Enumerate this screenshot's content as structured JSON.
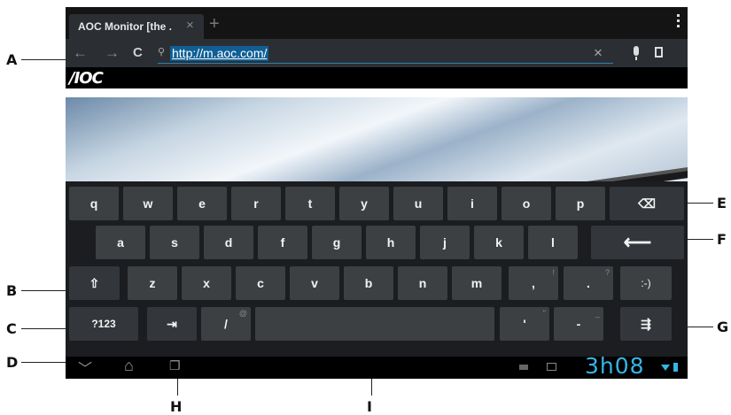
{
  "browser": {
    "tab_title": "AOC Monitor [the .",
    "tab_close": "×",
    "new_tab": "+",
    "url": "http://m.aoc.com/",
    "url_clear": "×",
    "back": "←",
    "forward": "→",
    "reload": "C",
    "search_glyph": "⚲"
  },
  "page": {
    "logo": "/IOC"
  },
  "keyboard": {
    "row1": [
      "q",
      "w",
      "e",
      "r",
      "t",
      "y",
      "u",
      "i",
      "o",
      "p"
    ],
    "row2": [
      "a",
      "s",
      "d",
      "f",
      "g",
      "h",
      "j",
      "k",
      "l"
    ],
    "row3": [
      "z",
      "x",
      "c",
      "v",
      "b",
      "n",
      "m"
    ],
    "comma": ",",
    "comma_hint": "!",
    "period": ".",
    "period_hint": "?",
    "smiley": ":-)",
    "symbols": "?123",
    "tab_glyph": "⇥",
    "slash": "/",
    "slash_hint": "@",
    "apostrophe": "'",
    "apostrophe_hint": "\"",
    "dash": "-",
    "dash_hint": "_",
    "backspace_glyph": "⌫",
    "enter_glyph": "⟵",
    "shift_glyph": "⇧",
    "settings_glyph": "⇶"
  },
  "system": {
    "time": "3h08",
    "back_glyph": "﹀",
    "home_glyph": "⌂",
    "recents_glyph": "❐"
  },
  "callouts": {
    "a": "A",
    "b": "B",
    "c": "C",
    "d": "D",
    "e": "E",
    "f": "F",
    "g": "G",
    "h": "H",
    "i": "I"
  }
}
